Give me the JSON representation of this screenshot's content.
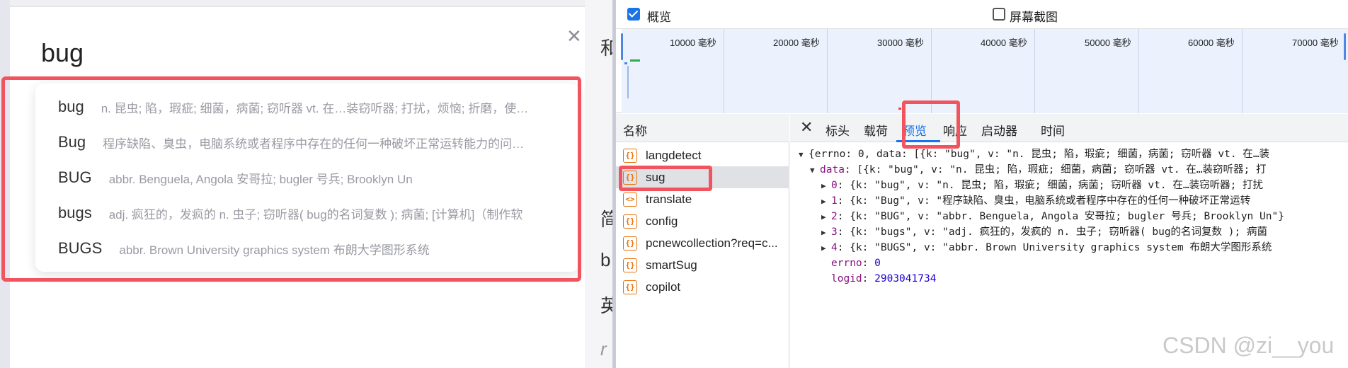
{
  "left": {
    "query": "bug",
    "suggestions": [
      {
        "word": "bug",
        "def": "n. 昆虫; 陷，瑕疵; 细菌，病菌; 窃听器 vt. 在…装窃听器; 打扰，烦恼; 折磨，使…"
      },
      {
        "word": "Bug",
        "def": "程序缺陷、臭虫，电脑系统或者程序中存在的任何一种破坏正常运转能力的问…"
      },
      {
        "word": "BUG",
        "def": "abbr. Benguela, Angola 安哥拉; bugler 号兵; Brooklyn Un"
      },
      {
        "word": "bugs",
        "def": "adj. 疯狂的，发疯的 n. 虫子; 窃听器( bug的名词复数 ); 病菌; [计算机]（制作软"
      },
      {
        "word": "BUGS",
        "def": "abbr. Brown University graphics system 布朗大学图形系统"
      }
    ],
    "peek_chars": [
      "和",
      "简",
      "b",
      "英",
      "r"
    ]
  },
  "devtools": {
    "overview_label": "概览",
    "screenshot_label": "屏幕截图",
    "timeline_labels": [
      "10000 毫秒",
      "20000 毫秒",
      "30000 毫秒",
      "40000 毫秒",
      "50000 毫秒",
      "60000 毫秒",
      "70000 毫秒"
    ],
    "names_header": "名称",
    "requests": [
      "langdetect",
      "sug",
      "translate",
      "config",
      "pcnewcollection?req=c...",
      "smartSug",
      "copilot"
    ],
    "selected_request": "sug",
    "tabs": [
      "标头",
      "载荷",
      "预览",
      "响应",
      "启动器",
      "时间"
    ],
    "active_tab": "预览",
    "preview": {
      "root": "{errno: 0, data: [{k: \"bug\", v: \"n. 昆虫; 陷，瑕疵; 细菌，病菌; 窃听器 vt. 在…装",
      "data_key": "data",
      "data_summary": ": [{k: \"bug\", v: \"n. 昆虫; 陷，瑕疵; 细菌，病菌; 窃听器 vt. 在…装窃听器; 打",
      "items": [
        {
          "idx": "0",
          "text": ": {k: \"bug\", v: \"n. 昆虫; 陷，瑕疵; 细菌，病菌; 窃听器 vt. 在…装窃听器; 打扰"
        },
        {
          "idx": "1",
          "text": ": {k: \"Bug\", v: \"程序缺陷、臭虫，电脑系统或者程序中存在的任何一种破坏正常运转"
        },
        {
          "idx": "2",
          "text": ": {k: \"BUG\", v: \"abbr. Benguela, Angola 安哥拉; bugler 号兵; Brooklyn Un\"}"
        },
        {
          "idx": "3",
          "text": ": {k: \"bugs\", v: \"adj. 疯狂的，发疯的 n. 虫子; 窃听器( bug的名词复数 ); 病菌"
        },
        {
          "idx": "4",
          "text": ": {k: \"BUGS\", v: \"abbr. Brown University graphics system 布朗大学图形系统"
        }
      ],
      "errno_key": "errno",
      "errno_val": "0",
      "logid_key": "logid",
      "logid_val": "2903041734"
    }
  },
  "watermark": "CSDN @zi__you",
  "colors": {
    "highlight": "#f1545f",
    "accent": "#1a73e8"
  }
}
